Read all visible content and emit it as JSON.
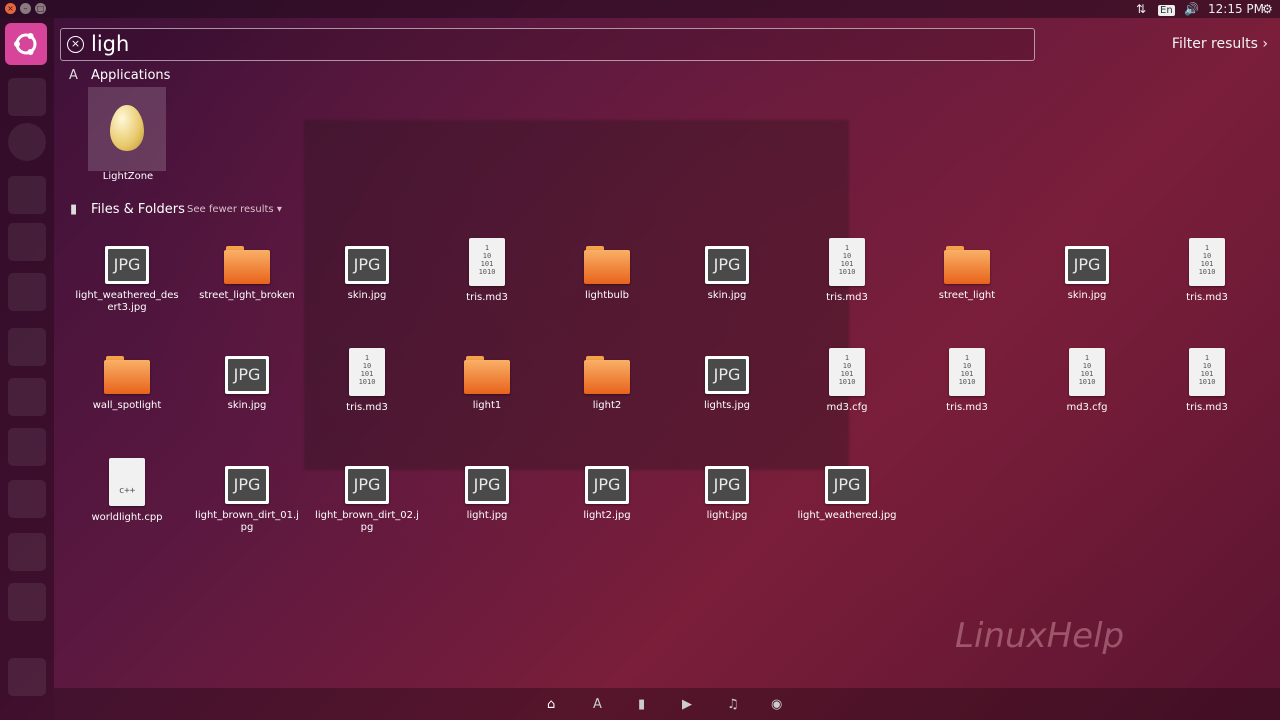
{
  "topbar": {
    "keyboard": "En",
    "clock": "12:15 PM"
  },
  "search": {
    "query": "ligh",
    "filter_label": "Filter results"
  },
  "applications": {
    "title": "Applications",
    "items": [
      {
        "label": "LightZone",
        "icon": "egg-icon"
      }
    ]
  },
  "files": {
    "title": "Files & Folders",
    "see_fewer": "See fewer results",
    "items": [
      {
        "label": "light_weathered_desert3.jpg",
        "type": "jpg"
      },
      {
        "label": "street_light_broken",
        "type": "folder"
      },
      {
        "label": "skin.jpg",
        "type": "jpg"
      },
      {
        "label": "tris.md3",
        "type": "bin"
      },
      {
        "label": "lightbulb",
        "type": "folder"
      },
      {
        "label": "skin.jpg",
        "type": "jpg"
      },
      {
        "label": "tris.md3",
        "type": "bin"
      },
      {
        "label": "street_light",
        "type": "folder"
      },
      {
        "label": "skin.jpg",
        "type": "jpg"
      },
      {
        "label": "tris.md3",
        "type": "bin"
      },
      {
        "label": "wall_spotlight",
        "type": "folder"
      },
      {
        "label": "skin.jpg",
        "type": "jpg"
      },
      {
        "label": "tris.md3",
        "type": "bin"
      },
      {
        "label": "light1",
        "type": "folder"
      },
      {
        "label": "light2",
        "type": "folder"
      },
      {
        "label": "lights.jpg",
        "type": "jpg"
      },
      {
        "label": "md3.cfg",
        "type": "bin"
      },
      {
        "label": "tris.md3",
        "type": "bin"
      },
      {
        "label": "md3.cfg",
        "type": "bin"
      },
      {
        "label": "tris.md3",
        "type": "bin"
      },
      {
        "label": "worldlight.cpp",
        "type": "cpp"
      },
      {
        "label": "light_brown_dirt_01.jpg",
        "type": "jpg"
      },
      {
        "label": "light_brown_dirt_02.jpg",
        "type": "jpg"
      },
      {
        "label": "light.jpg",
        "type": "jpg"
      },
      {
        "label": "light2.jpg",
        "type": "jpg"
      },
      {
        "label": "light.jpg",
        "type": "jpg"
      },
      {
        "label": "light_weathered.jpg",
        "type": "jpg"
      }
    ],
    "jpg_text": "JPG",
    "bin_text": "1\n10\n101\n1010",
    "cpp_text": "c++"
  },
  "watermark": "LinuxHelp"
}
